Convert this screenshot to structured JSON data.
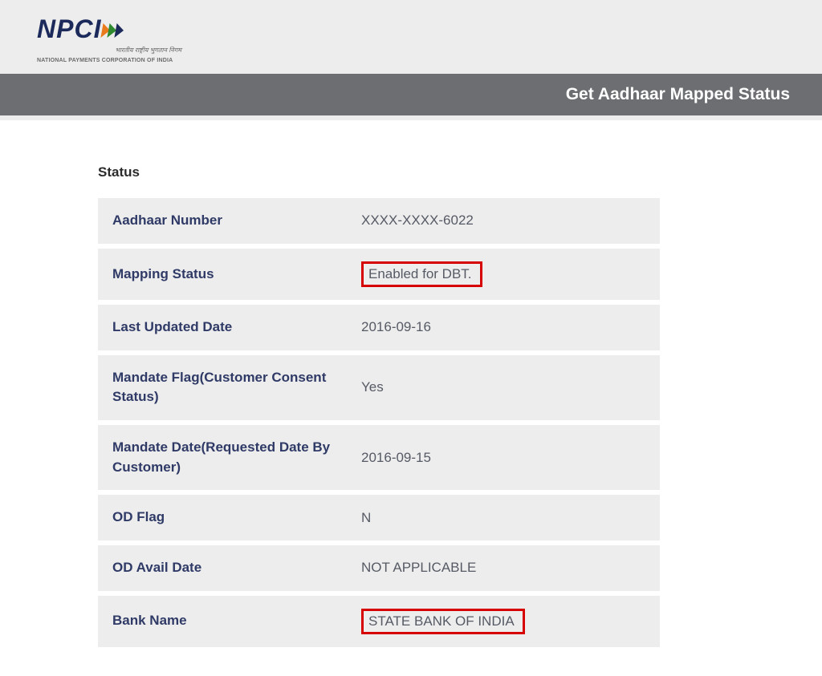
{
  "logo": {
    "text": "NPCI",
    "tagline_hi": "भारतीय राष्ट्रीय भुगतान निगम",
    "tagline_en": "NATIONAL PAYMENTS CORPORATION OF INDIA"
  },
  "header": {
    "title": "Get Aadhaar Mapped Status"
  },
  "section_title": "Status",
  "rows": [
    {
      "label": "Aadhaar Number",
      "value": "XXXX-XXXX-6022",
      "highlight": false
    },
    {
      "label": "Mapping Status",
      "value": "Enabled for DBT.",
      "highlight": true
    },
    {
      "label": "Last Updated Date",
      "value": "2016-09-16",
      "highlight": false
    },
    {
      "label": "Mandate Flag(Customer Consent Status)",
      "value": "Yes",
      "highlight": false
    },
    {
      "label": "Mandate Date(Requested Date By Customer)",
      "value": "2016-09-15",
      "highlight": false
    },
    {
      "label": "OD Flag",
      "value": "N",
      "highlight": false
    },
    {
      "label": "OD Avail Date",
      "value": "NOT APPLICABLE",
      "highlight": false
    },
    {
      "label": "Bank Name",
      "value": "STATE BANK OF INDIA",
      "highlight": true
    }
  ]
}
